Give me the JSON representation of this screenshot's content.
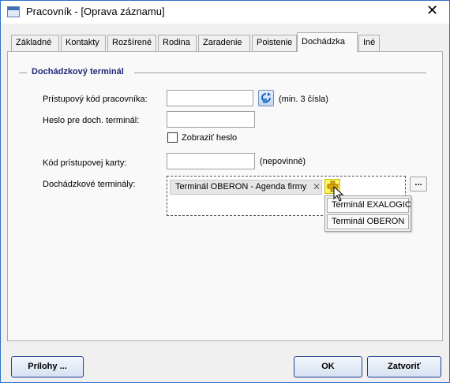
{
  "window": {
    "title": "Pracovník - [Oprava záznamu]",
    "close_glyph": "✕"
  },
  "tabs": [
    {
      "label": "Základné",
      "active": false
    },
    {
      "label": "Kontakty",
      "active": false
    },
    {
      "label": "Rozšírené",
      "active": false
    },
    {
      "label": "Rodina",
      "active": false
    },
    {
      "label": "Zaradenie",
      "active": false
    },
    {
      "label": "Poistenie",
      "active": false
    },
    {
      "label": "Dochádzka",
      "active": true
    },
    {
      "label": "Iné",
      "active": false
    }
  ],
  "group": {
    "title": "Dochádzkový terminál"
  },
  "form": {
    "access_code": {
      "label": "Prístupový kód pracovníka:",
      "value": "",
      "hint": "(min. 3 čísla)"
    },
    "password": {
      "label": "Heslo pre doch. terminál:",
      "value": ""
    },
    "show_password": {
      "label": "Zobraziť heslo",
      "checked": false
    },
    "card_code": {
      "label": "Kód prístupovej karty:",
      "value": "",
      "hint": "(nepovinné)"
    },
    "terminals": {
      "label": "Dochádzkové terminály:",
      "selected": [
        {
          "label": "Terminál OBERON - Agenda firmy",
          "remove_glyph": "✕"
        }
      ],
      "browse_label": "...",
      "dropdown_options": [
        "Terminál EXALOGIC",
        "Terminál OBERON"
      ]
    }
  },
  "buttons": {
    "attachments": "Prílohy ...",
    "ok": "OK",
    "close": "Zatvoriť"
  },
  "colors": {
    "accent": "#1e3f8f",
    "group_title": "#1f2a78",
    "add_button": "#fff566"
  }
}
